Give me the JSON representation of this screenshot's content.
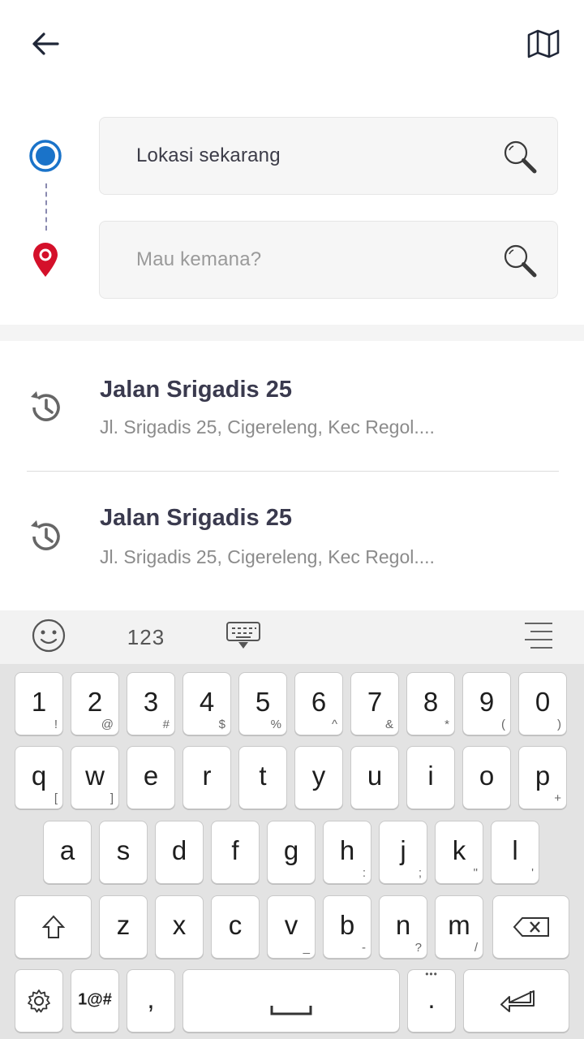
{
  "header": {
    "back_icon": "arrow-left-icon",
    "map_icon": "map-icon"
  },
  "route": {
    "origin_placeholder": "Lokasi sekarang",
    "destination_placeholder": "Mau kemana?",
    "origin_color": "#1a73c9",
    "destination_color": "#d4102a"
  },
  "history": [
    {
      "title": "Jalan Srigadis 25",
      "subtitle": "Jl. Srigadis 25, Cigereleng, Kec Regol...."
    },
    {
      "title": "Jalan Srigadis 25",
      "subtitle": "Jl. Srigadis 25, Cigereleng, Kec Regol...."
    }
  ],
  "keyboard": {
    "toolbar": {
      "numbers_label": "123"
    },
    "row1": [
      {
        "k": "1",
        "a": "!"
      },
      {
        "k": "2",
        "a": "@"
      },
      {
        "k": "3",
        "a": "#"
      },
      {
        "k": "4",
        "a": "$"
      },
      {
        "k": "5",
        "a": "%"
      },
      {
        "k": "6",
        "a": "^"
      },
      {
        "k": "7",
        "a": "&"
      },
      {
        "k": "8",
        "a": "*"
      },
      {
        "k": "9",
        "a": "("
      },
      {
        "k": "0",
        "a": ")"
      }
    ],
    "row2": [
      {
        "k": "q",
        "a": "["
      },
      {
        "k": "w",
        "a": "]"
      },
      {
        "k": "e",
        "a": ""
      },
      {
        "k": "r",
        "a": ""
      },
      {
        "k": "t",
        "a": ""
      },
      {
        "k": "y",
        "a": ""
      },
      {
        "k": "u",
        "a": ""
      },
      {
        "k": "i",
        "a": ""
      },
      {
        "k": "o",
        "a": ""
      },
      {
        "k": "p",
        "a": "+"
      }
    ],
    "row3": [
      {
        "k": "a",
        "a": ""
      },
      {
        "k": "s",
        "a": ""
      },
      {
        "k": "d",
        "a": ""
      },
      {
        "k": "f",
        "a": ""
      },
      {
        "k": "g",
        "a": ""
      },
      {
        "k": "h",
        "a": ":"
      },
      {
        "k": "j",
        "a": ";"
      },
      {
        "k": "k",
        "a": "\""
      },
      {
        "k": "l",
        "a": "'"
      }
    ],
    "row4": [
      {
        "k": "z",
        "a": ""
      },
      {
        "k": "x",
        "a": ""
      },
      {
        "k": "c",
        "a": ""
      },
      {
        "k": "v",
        "a": "_"
      },
      {
        "k": "b",
        "a": "-"
      },
      {
        "k": "n",
        "a": "?"
      },
      {
        "k": "m",
        "a": "/"
      }
    ],
    "symbols_label": "1@#",
    "comma_label": ",",
    "period_label": ".",
    "period_alt": "•••"
  }
}
